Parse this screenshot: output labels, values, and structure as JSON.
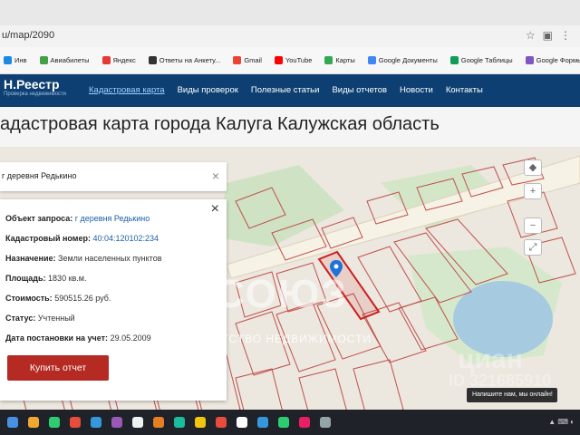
{
  "browser": {
    "url": "u/map/2090",
    "bookmarks": [
      {
        "label": "Инв",
        "color": "#1e88e5"
      },
      {
        "label": "Авиабилеты",
        "color": "#43a047"
      },
      {
        "label": "Яндекс",
        "color": "#e53935"
      },
      {
        "label": "Ответы на Анкету...",
        "color": "#333333"
      },
      {
        "label": "Gmail",
        "color": "#ea4335"
      },
      {
        "label": "YouTube",
        "color": "#ff0000"
      },
      {
        "label": "Карты",
        "color": "#34a853"
      },
      {
        "label": "Google Документы",
        "color": "#4285f4"
      },
      {
        "label": "Google Таблицы",
        "color": "#0f9d58"
      },
      {
        "label": "Google Формы",
        "color": "#7e57c2"
      }
    ]
  },
  "site": {
    "logo_title": "Н.Реестр",
    "logo_subtitle": "Проверка недвижимости",
    "nav": [
      {
        "label": "Кадастровая карта",
        "active": true
      },
      {
        "label": "Виды проверок",
        "active": false
      },
      {
        "label": "Полезные статьи",
        "active": false
      },
      {
        "label": "Виды отчетов",
        "active": false
      },
      {
        "label": "Новости",
        "active": false
      },
      {
        "label": "Контакты",
        "active": false
      }
    ]
  },
  "page": {
    "title": "адастровая карта города Калуга Калужская область"
  },
  "search": {
    "value": "г деревня Редькино",
    "close_glyph": "×"
  },
  "info": {
    "close_glyph": "×",
    "rows": [
      {
        "key": "Объект запроса:",
        "value": "г деревня Редькино",
        "link": true
      },
      {
        "key": "Кадастровый номер:",
        "value": "40:04:120102:234",
        "link": true
      },
      {
        "key": "Назначение:",
        "value": "Земли населенных пунктов",
        "link": false
      },
      {
        "key": "Площадь:",
        "value": "1830 кв.м.",
        "link": false
      },
      {
        "key": "Стоимость:",
        "value": "590515.26 руб.",
        "link": false
      },
      {
        "key": "Статус:",
        "value": "Учтенный",
        "link": false
      },
      {
        "key": "Дата постановки на учет:",
        "value": "29.05.2009",
        "link": false
      }
    ],
    "buy_button": "Купить отчет"
  },
  "map_controls": [
    "◆",
    "+",
    "−",
    "⤢"
  ],
  "watermark": {
    "big": "СОЮЗ",
    "small": "АГЕНТСТВО   НЕДВИЖИМОСТИ",
    "cian": "циан",
    "id": "ID 321685910"
  },
  "chat": {
    "label": "Напишите нам, мы онлайн!"
  },
  "colors": {
    "header_bg": "#0d3f72",
    "button_bg": "#b52a22",
    "parcel_stroke": "#c0504d",
    "selected_parcel": "#cc1f1f",
    "water": "#a6cbe0"
  },
  "taskbar_icons": [
    "#4a90e2",
    "#f0a830",
    "#2ecc71",
    "#e74c3c",
    "#3498db",
    "#9b59b6",
    "#ecf0f1",
    "#e67e22",
    "#1abc9c",
    "#f1c40f",
    "#e74c3c",
    "#ffffff",
    "#3498db",
    "#2ecc71",
    "#e91e63",
    "#95a5a6"
  ]
}
